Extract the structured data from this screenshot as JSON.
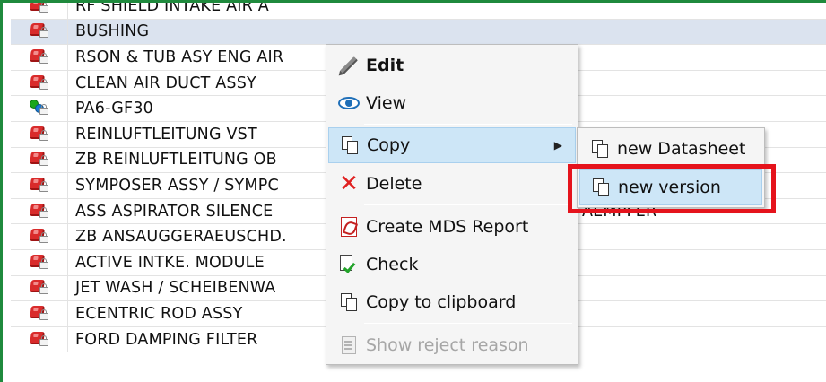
{
  "table": {
    "rows": [
      {
        "name": "RF SHIELD INTAKE AIR A",
        "status": "red"
      },
      {
        "name": "BUSHING",
        "status": "red",
        "selected": true
      },
      {
        "name": "RSON & TUB ASY ENG AIR",
        "status": "red"
      },
      {
        "name": "CLEAN AIR DUCT ASSY",
        "status": "red"
      },
      {
        "name": "PA6-GF30",
        "status": "green"
      },
      {
        "name": "REINLUFTLEITUNG VST",
        "status": "red"
      },
      {
        "name": "ZB REINLUFTLEITUNG OB",
        "status": "red"
      },
      {
        "name": "SYMPOSER ASSY / SYMPC",
        "status": "red"
      },
      {
        "name": "ASS ASPIRATOR SILENCE",
        "suffix": "AEMPFER",
        "status": "red"
      },
      {
        "name": "ZB ANSAUGGERAEUSCHD.",
        "status": "red"
      },
      {
        "name": "ACTIVE INTKE. MODULE",
        "status": "red"
      },
      {
        "name": "JET WASH / SCHEIBENWA",
        "status": "red"
      },
      {
        "name": "ECENTRIC ROD ASSY",
        "status": "red"
      },
      {
        "name": "FORD DAMPING FILTER",
        "status": "red"
      }
    ]
  },
  "context_menu": {
    "edit": "Edit",
    "view": "View",
    "copy": "Copy",
    "delete": "Delete",
    "create_mds_report": "Create MDS Report",
    "check": "Check",
    "copy_to_clipboard": "Copy to clipboard",
    "show_reject_reason": "Show reject reason"
  },
  "copy_submenu": {
    "new_datasheet": "new Datasheet",
    "new_version": "new version"
  },
  "colors": {
    "frame_border": "#1f8a3d",
    "highlight_box": "#e5131c",
    "menu_hover": "#cde6f7",
    "selected_row": "#dbe3ef"
  }
}
